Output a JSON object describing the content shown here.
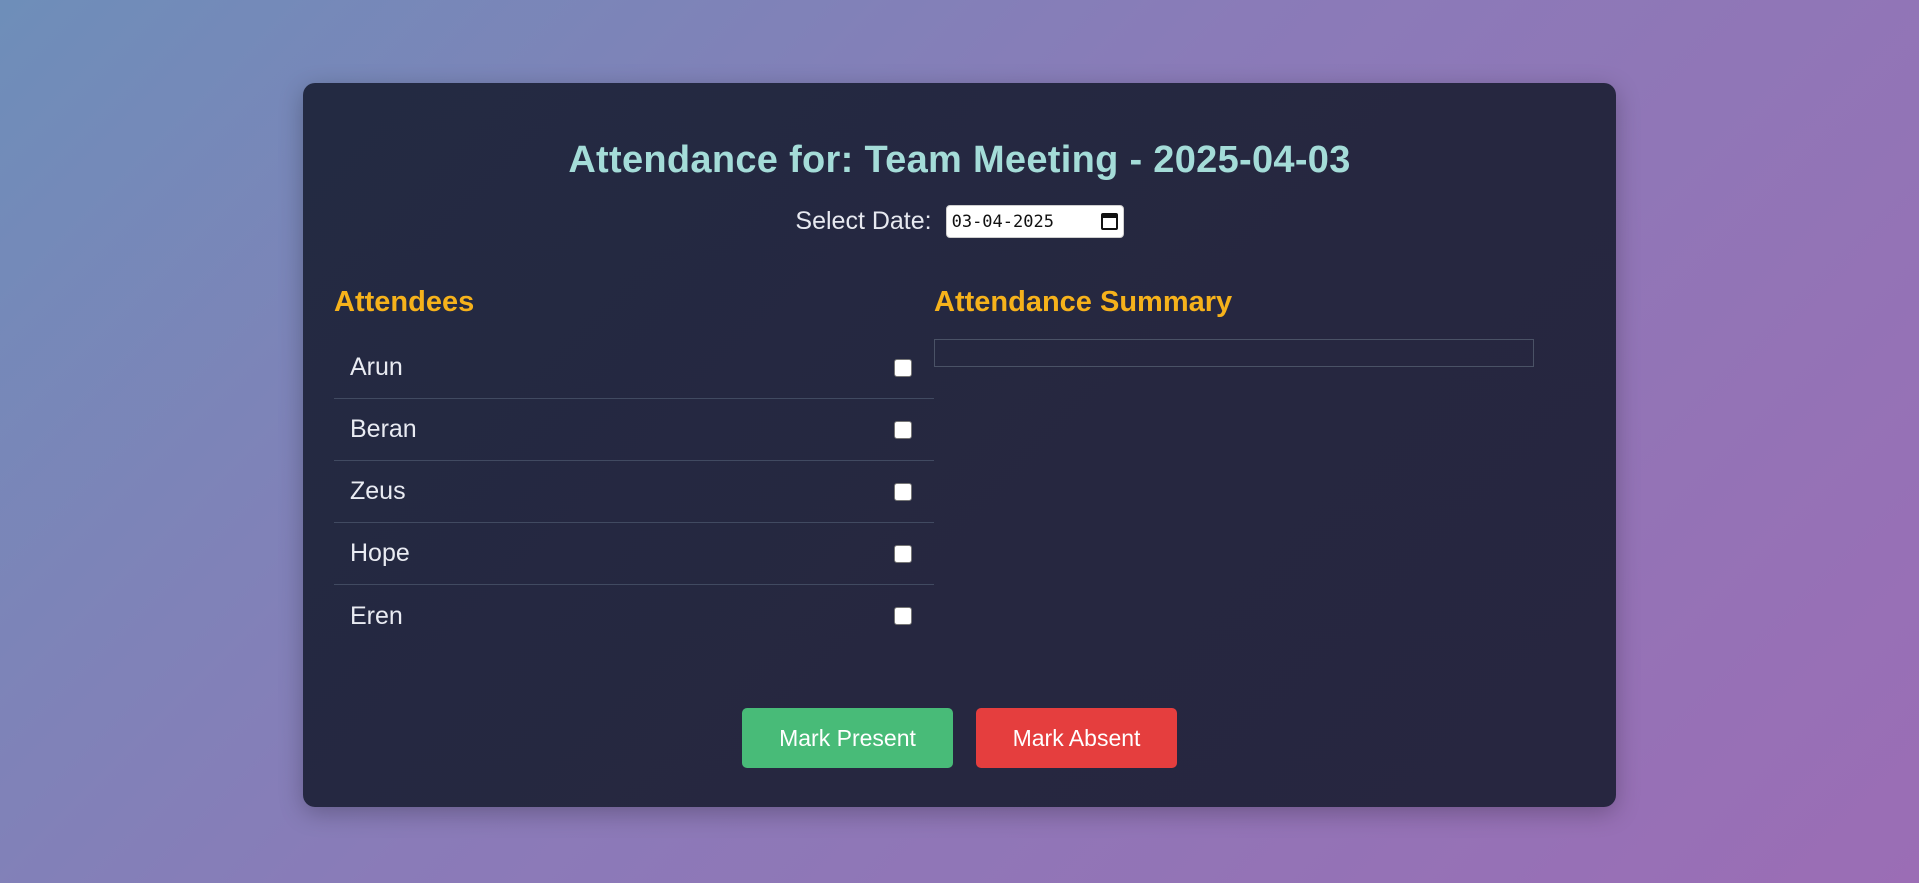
{
  "card": {
    "title": "Attendance for: Team Meeting - 2025-04-03",
    "date_label": "Select Date:",
    "date_value": "03-04-2025"
  },
  "attendees": {
    "heading": "Attendees",
    "items": [
      {
        "name": "Arun",
        "checked": false
      },
      {
        "name": "Beran",
        "checked": false
      },
      {
        "name": "Zeus",
        "checked": false
      },
      {
        "name": "Hope",
        "checked": false
      },
      {
        "name": "Eren",
        "checked": false
      }
    ]
  },
  "summary": {
    "heading": "Attendance Summary",
    "content": ""
  },
  "actions": {
    "present_label": "Mark Present",
    "absent_label": "Mark Absent"
  },
  "colors": {
    "title": "#a4dcd8",
    "heading_accent": "#f6b21b",
    "present_button": "#48bb78",
    "absent_button": "#e53e3e",
    "card_background": "#242942"
  },
  "icons": {
    "date_picker": "calendar-icon"
  }
}
